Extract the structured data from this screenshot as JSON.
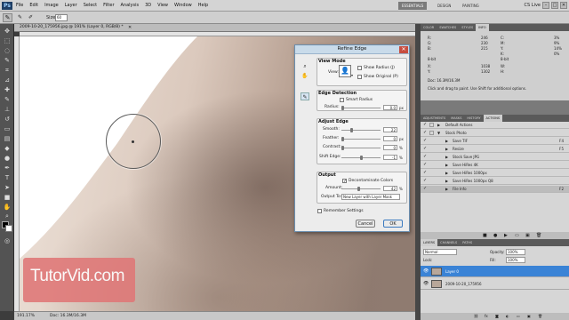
{
  "app": {
    "logo": "Ps"
  },
  "menu": [
    "File",
    "Edit",
    "Image",
    "Layer",
    "Select",
    "Filter",
    "Analysis",
    "3D",
    "View",
    "Window",
    "Help"
  ],
  "workspaces": [
    "ESSENTIALS",
    "DESIGN",
    "PAINTING"
  ],
  "cs_live": "CS Live",
  "window_controls": [
    "–",
    "□",
    "✕"
  ],
  "options": {
    "size_label": "Size:",
    "size_value": "60"
  },
  "document": {
    "tab_title": "2009-10-20_175956.jpg @ 191% (Layer 0, RGB/8) *",
    "zoom": "191.17%",
    "doc_size": "Doc: 16.3M/16.3M"
  },
  "watermark": {
    "text": "TutorVid.com",
    "color": "#e07777"
  },
  "dialog": {
    "title": "Refine Edge",
    "close": "✕",
    "view_mode": {
      "heading": "View Mode",
      "view_label": "View:",
      "show_radius": "Show Radius (J)",
      "show_original": "Show Original (P)"
    },
    "edge_detection": {
      "heading": "Edge Detection",
      "smart_radius": "Smart Radius",
      "radius_label": "Radius:",
      "radius_value": "0.0",
      "radius_unit": "px"
    },
    "adjust_edge": {
      "heading": "Adjust Edge",
      "smooth_label": "Smooth:",
      "smooth_value": "22",
      "feather_label": "Feather:",
      "feather_value": "0",
      "feather_unit": "px",
      "contrast_label": "Contrast:",
      "contrast_value": "0",
      "contrast_unit": "%",
      "shift_label": "Shift Edge:",
      "shift_value": "-1",
      "shift_unit": "%"
    },
    "output": {
      "heading": "Output",
      "decontaminate": "Decontaminate Colors",
      "amount_label": "Amount:",
      "amount_value": "42",
      "amount_unit": "%",
      "output_to_label": "Output To:",
      "output_to_value": "New Layer with Layer Mask"
    },
    "remember": "Remember Settings",
    "cancel": "Cancel",
    "ok": "OK"
  },
  "panels": {
    "top_tabs": [
      "COLOR",
      "SWATCHES",
      "STYLES",
      "INFO"
    ],
    "info": {
      "r_label": "R:",
      "r_value": "246",
      "g_label": "G:",
      "g_value": "230",
      "b_label": "B:",
      "b_value": "215",
      "c_label": "C:",
      "c_value": "3%",
      "m_label": "M:",
      "m_value": "9%",
      "y_label": "Y:",
      "y_value": "14%",
      "k_label": "K:",
      "k_value": "0%",
      "bit_left": "8-bit",
      "bit_right": "8-bit",
      "x_label": "X:",
      "x_value": "1038",
      "y2_label": "Y:",
      "y2_value": "1302",
      "w_label": "W:",
      "h_label": "H:",
      "doc": "Doc: 16.3M/16.3M",
      "hint": "Click and drag to paint. Use Shift for additional options."
    },
    "actions_tabs": [
      "ADJUSTMENTS",
      "MASKS",
      "HISTORY",
      "ACTIONS"
    ],
    "actions": [
      {
        "name": "Default Actions",
        "key": "",
        "level": 0
      },
      {
        "name": "Stock Photo",
        "key": "",
        "level": 0
      },
      {
        "name": "Save TIF",
        "key": "F4",
        "level": 1
      },
      {
        "name": "Resize",
        "key": "F5",
        "level": 1
      },
      {
        "name": "Stock Save JPG",
        "key": "",
        "level": 1
      },
      {
        "name": "Save HiRes 4K",
        "key": "",
        "level": 1
      },
      {
        "name": "Save HiRes 1000px",
        "key": "",
        "level": 1
      },
      {
        "name": "Save HiRes 1000px Q8",
        "key": "",
        "level": 1
      },
      {
        "name": "File Info",
        "key": "F2",
        "level": 1
      }
    ],
    "layers_tabs": [
      "LAYERS",
      "CHANNELS",
      "PATHS"
    ],
    "layers": {
      "blend_mode": "Normal",
      "opacity_label": "Opacity:",
      "opacity_value": "100%",
      "lock_label": "Lock:",
      "fill_label": "Fill:",
      "fill_value": "100%",
      "items": [
        {
          "name": "Layer 0",
          "selected": true
        },
        {
          "name": "2009-10-20_175956",
          "selected": false
        }
      ]
    }
  },
  "colors": {
    "accent": "#3a83d6",
    "dialog_titlebar": "#c9dbea"
  }
}
